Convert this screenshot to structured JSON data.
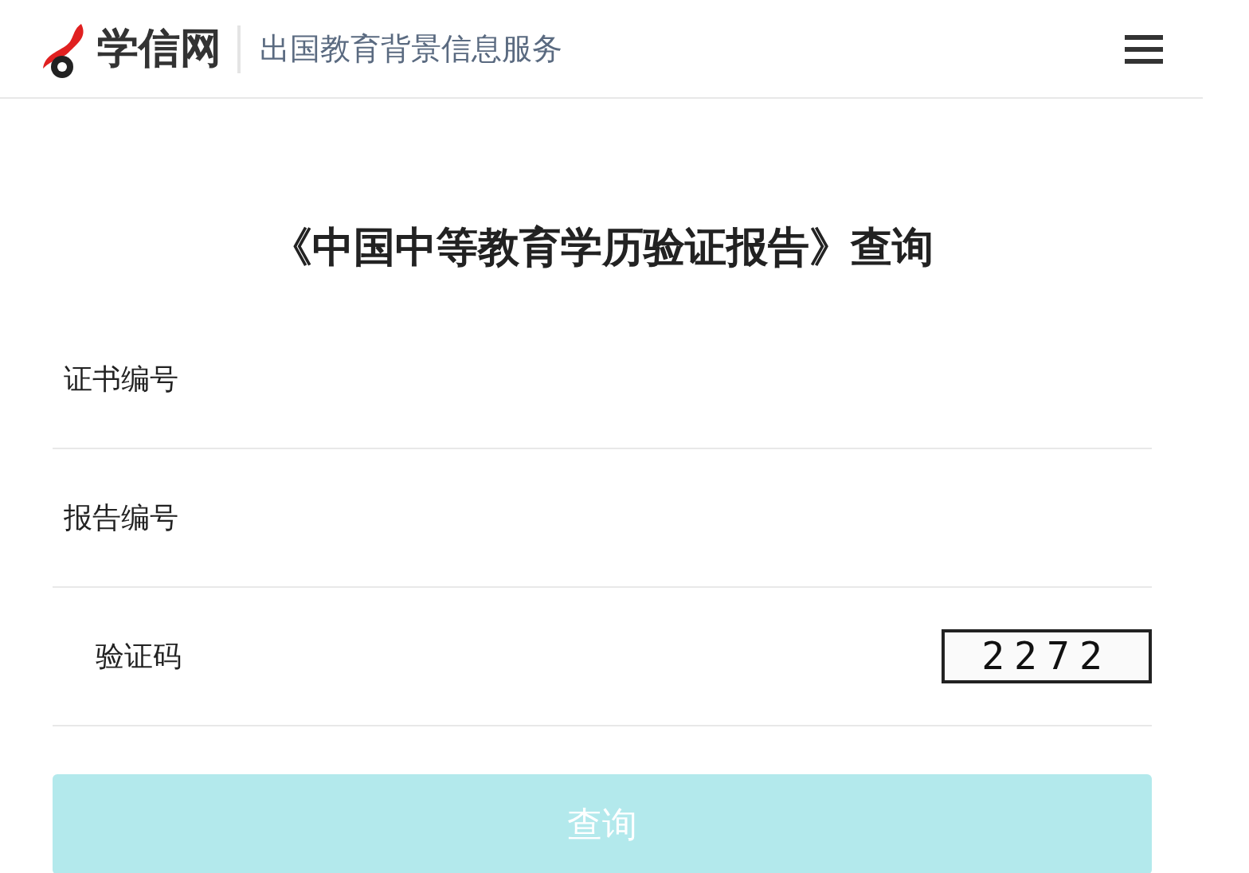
{
  "header": {
    "brand": "学信网",
    "tagline": "出国教育背景信息服务"
  },
  "title": "《中国中等教育学历验证报告》查询",
  "fields": [
    {
      "kind": "text",
      "label": "证书编号"
    },
    {
      "kind": "text",
      "label": "报告编号"
    },
    {
      "kind": "captcha",
      "label": "验证码",
      "captcha": "2272"
    }
  ],
  "submit": {
    "label": "查询",
    "disabled": true
  }
}
